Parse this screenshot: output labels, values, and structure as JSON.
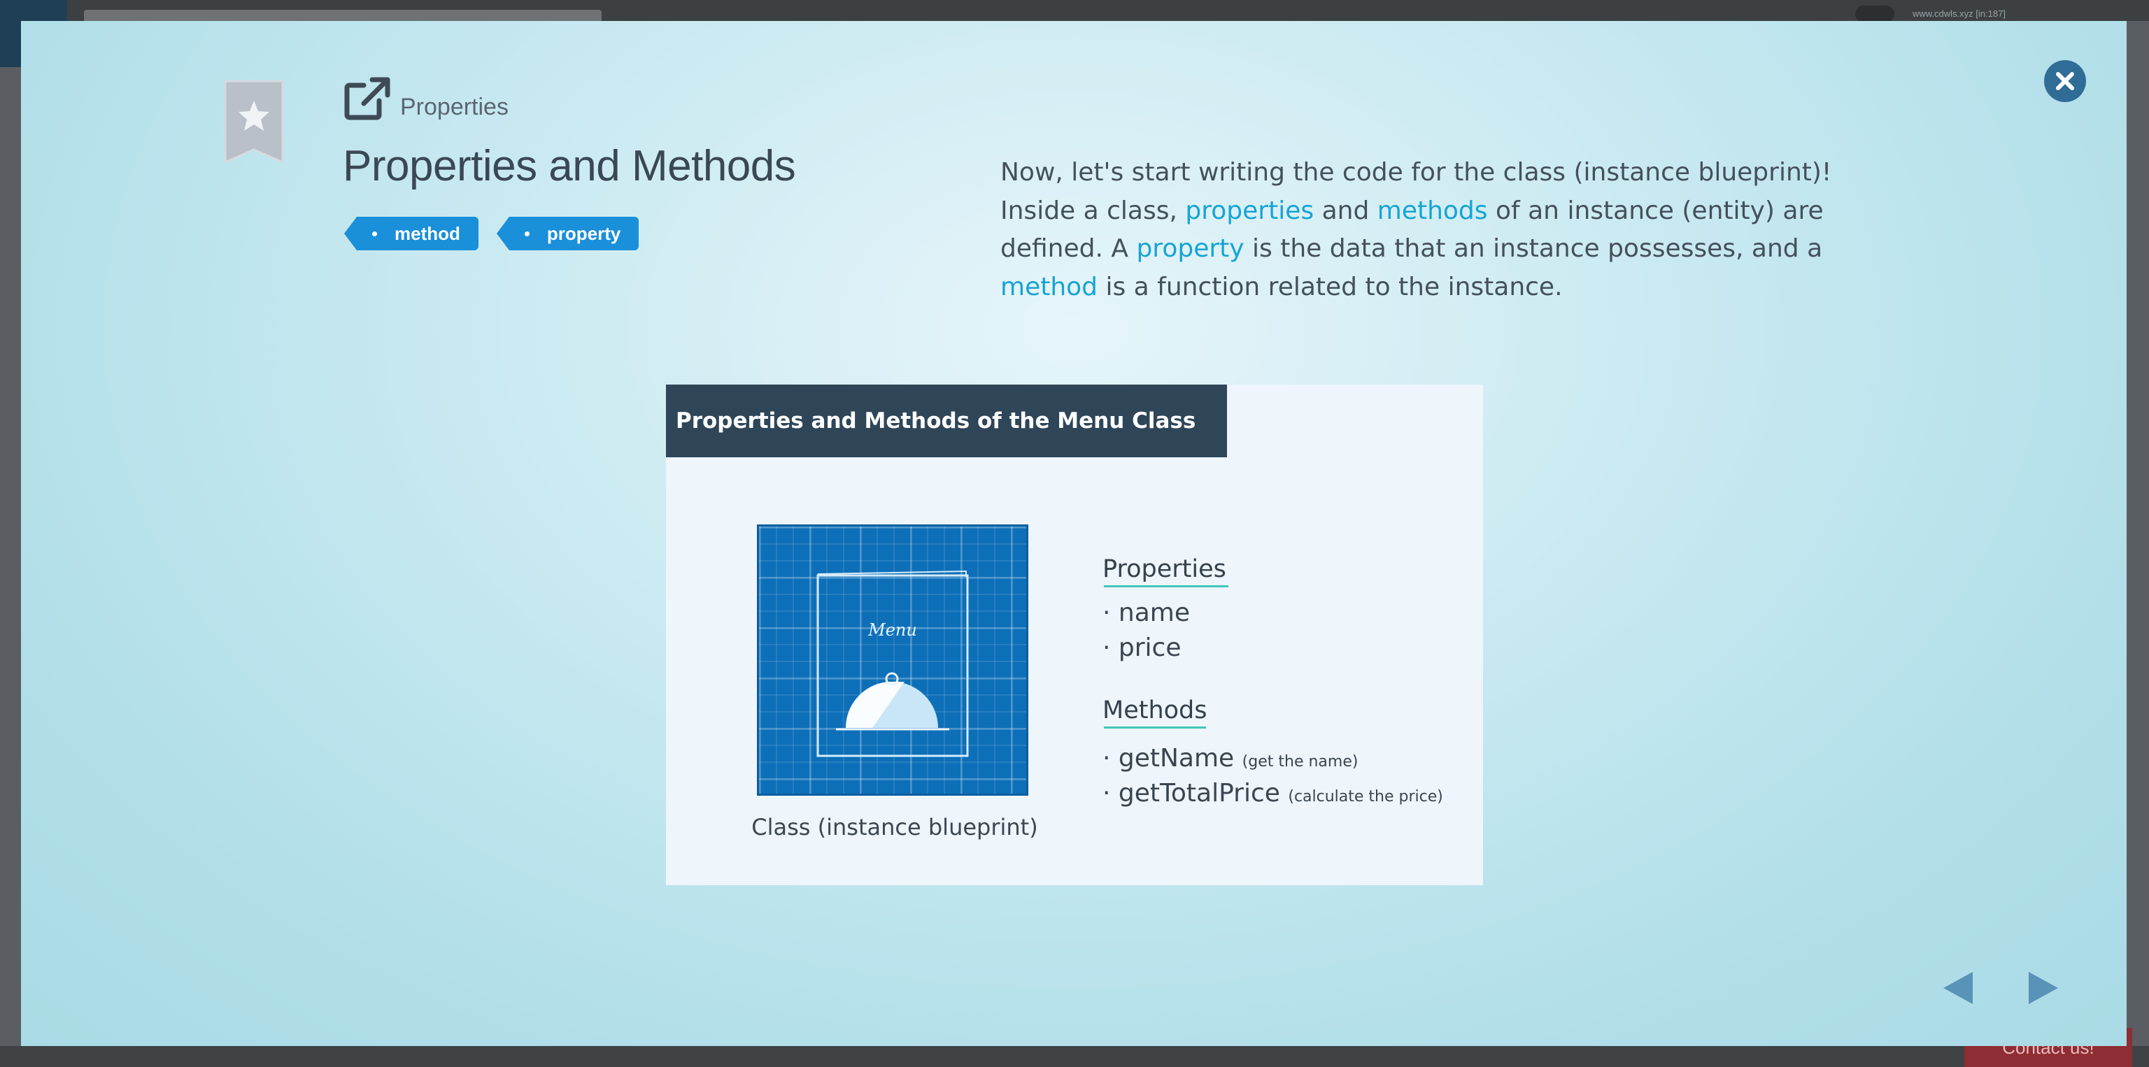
{
  "background": {
    "user_text": "www.cdwls.xyz [in:187]",
    "contact_label": "Contact us!"
  },
  "modal": {
    "section_label": "Properties",
    "title": "Properties and Methods",
    "tags": [
      {
        "label": "method"
      },
      {
        "label": "property"
      }
    ],
    "description": {
      "p1": "Now, let's start writing the code for the class (instance blueprint)! Inside a class, ",
      "k1": "properties",
      "p2": " and ",
      "k2": "methods",
      "p3": " of an instance (entity) are defined. A ",
      "k3": "property",
      "p4": " is the data that an instance possesses, and a ",
      "k4": "method",
      "p5": " is a function related to the instance."
    },
    "slide": {
      "title": "Properties and Methods of the Menu Class",
      "blueprint_menu_text": "Menu",
      "caption": "Class (instance blueprint)",
      "properties_heading": "Properties",
      "properties": [
        "· name",
        "· price"
      ],
      "methods_heading": "Methods",
      "methods": [
        {
          "name": "· getName",
          "note": "(get the name)"
        },
        {
          "name": "· getTotalPrice",
          "note": "(calculate the price)"
        }
      ]
    },
    "colors": {
      "accent": "#1a8fda",
      "keyword": "#16a4d4",
      "close": "#2f6d96",
      "nav_arrow": "#5a93b8"
    },
    "icons": {
      "close": "close-icon",
      "bookmark": "bookmark-star-icon",
      "external": "external-link-icon",
      "prev": "arrow-left-icon",
      "next": "arrow-right-icon"
    }
  }
}
